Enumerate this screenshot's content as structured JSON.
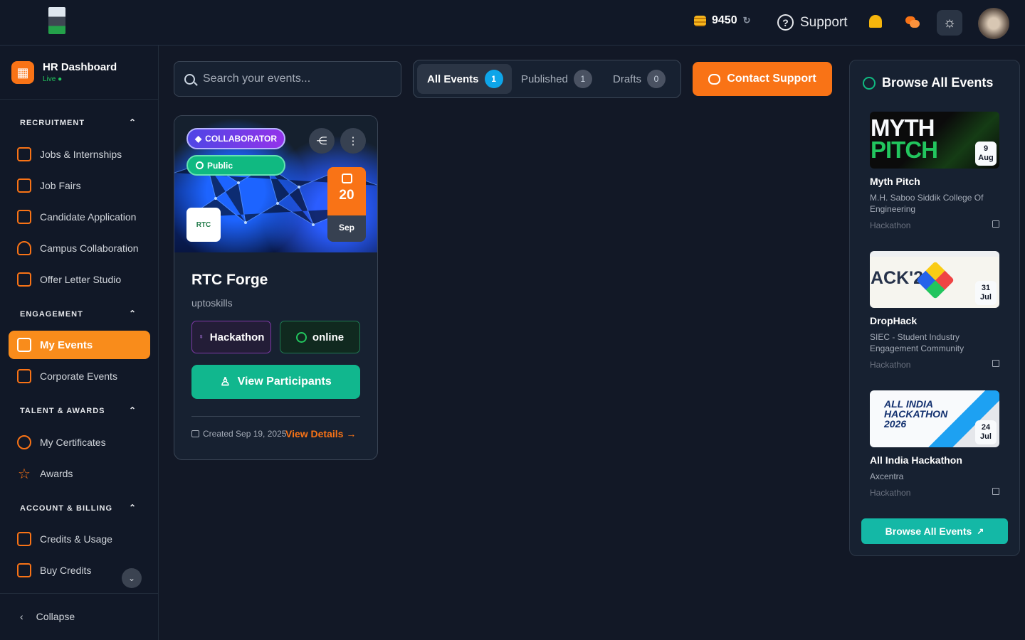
{
  "header": {
    "credits": "9450",
    "support_label": "Support"
  },
  "sidebar": {
    "brand": {
      "title": "HR Dashboard",
      "status": "Live"
    },
    "sections": {
      "recruitment": "RECRUITMENT",
      "engagement": "ENGAGEMENT",
      "talent": "TALENT & AWARDS",
      "account": "ACCOUNT & BILLING"
    },
    "items": {
      "jobs": "Jobs & Internships",
      "job_fairs": "Job Fairs",
      "candidate": "Candidate Application",
      "campus": "Campus Collaboration",
      "offer": "Offer Letter Studio",
      "my_events": "My Events",
      "corporate": "Corporate Events",
      "certificates": "My Certificates",
      "awards": "Awards",
      "credits": "Credits & Usage",
      "buy": "Buy Credits"
    },
    "collapse": "Collapse"
  },
  "search": {
    "placeholder": "Search your events..."
  },
  "tabs": [
    {
      "label": "All Events",
      "count": "1"
    },
    {
      "label": "Published",
      "count": "1"
    },
    {
      "label": "Drafts",
      "count": "0"
    }
  ],
  "contact_label": "Contact Support",
  "event_card": {
    "collaborator": "COLLABORATOR",
    "visibility": "Public",
    "day": "20",
    "month": "Sep",
    "title": "RTC Forge",
    "organizer": "uptoskills",
    "type": "Hackathon",
    "mode": "online",
    "view_label": "View Participants",
    "created": "Created Sep 19, 2025",
    "details_label": "View Details"
  },
  "browse_panel": {
    "title": "Browse All Events",
    "events": [
      {
        "name": "Myth Pitch",
        "org": "M.H. Saboo Siddik College Of Engineering",
        "type": "Hackathon",
        "day": "9",
        "month": "Aug"
      },
      {
        "name": "DropHack",
        "org": "SIEC - Student Industry Engagement Community",
        "type": "Hackathon",
        "day": "31",
        "month": "Jul"
      },
      {
        "name": "All India Hackathon",
        "org": "Axcentra",
        "type": "Hackathon",
        "day": "24",
        "month": "Jul"
      }
    ],
    "button_label": "Browse All Events"
  },
  "colors": {
    "accent": "#f97316",
    "teal": "#14b8a6",
    "background": "#121826"
  }
}
